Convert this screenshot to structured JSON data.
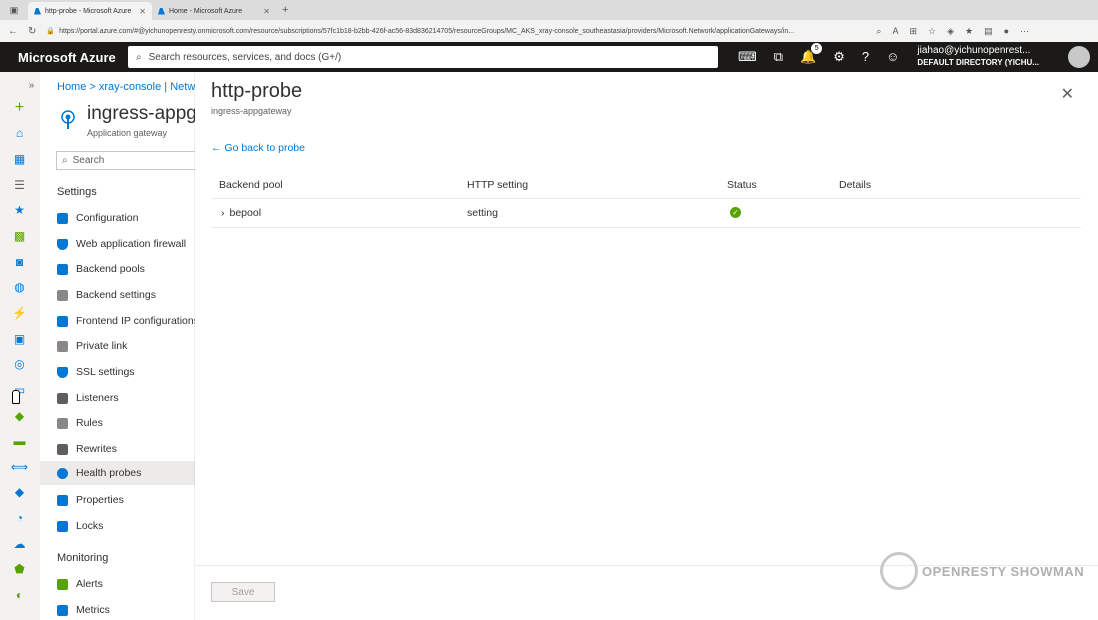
{
  "browser": {
    "tabs": [
      {
        "title": "http-probe - Microsoft Azure",
        "active": true
      },
      {
        "title": "Home - Microsoft Azure",
        "active": false
      }
    ],
    "url": "https://portal.azure.com/#@yichunopenresty.onmicrosoft.com/resource/subscriptions/57fc1b18-b2bb-426f-ac56-83d836214705/resourceGroups/MC_AKS_xray-console_southeastasia/providers/Microsoft.Network/applicationGateways/in..."
  },
  "header": {
    "brand": "Microsoft Azure",
    "search_placeholder": "Search resources, services, and docs (G+/)",
    "notifications_count": "5",
    "account_name": "jiahao@yichunopenrest...",
    "account_directory": "DEFAULT DIRECTORY (YICHU..."
  },
  "blade": {
    "breadcrumb": "Home  >  xray-console | Netw",
    "resource_title": "ingress-appgate",
    "resource_type": "Application gateway",
    "search_placeholder": "Search",
    "sections": {
      "settings": "Settings",
      "monitoring": "Monitoring"
    },
    "menu": [
      {
        "label": "Configuration",
        "color": "#0078d4"
      },
      {
        "label": "Web application firewall",
        "color": "#0078d4"
      },
      {
        "label": "Backend pools",
        "color": "#0078d4"
      },
      {
        "label": "Backend settings",
        "color": "#605e5c"
      },
      {
        "label": "Frontend IP configurations",
        "color": "#0078d4"
      },
      {
        "label": "Private link",
        "color": "#605e5c"
      },
      {
        "label": "SSL settings",
        "color": "#0078d4"
      },
      {
        "label": "Listeners",
        "color": "#605e5c"
      },
      {
        "label": "Rules",
        "color": "#605e5c"
      },
      {
        "label": "Rewrites",
        "color": "#605e5c"
      },
      {
        "label": "Health probes",
        "color": "#0078d4",
        "active": true
      },
      {
        "label": "Properties",
        "color": "#0078d4"
      },
      {
        "label": "Locks",
        "color": "#0078d4"
      }
    ],
    "monitoring_menu": [
      {
        "label": "Alerts",
        "color": "#57a300"
      },
      {
        "label": "Metrics",
        "color": "#0078d4"
      }
    ]
  },
  "panel": {
    "title": "http-probe",
    "subtitle": "ingress-appgateway",
    "back_link": "Go back to probe",
    "columns": {
      "backend_pool": "Backend pool",
      "http_setting": "HTTP setting",
      "status": "Status",
      "details": "Details"
    },
    "rows": [
      {
        "backend_pool": "bepool",
        "http_setting": "setting",
        "status": "healthy",
        "details": ""
      }
    ],
    "save_label": "Save"
  },
  "watermark": "OPENRESTY SHOWMAN"
}
